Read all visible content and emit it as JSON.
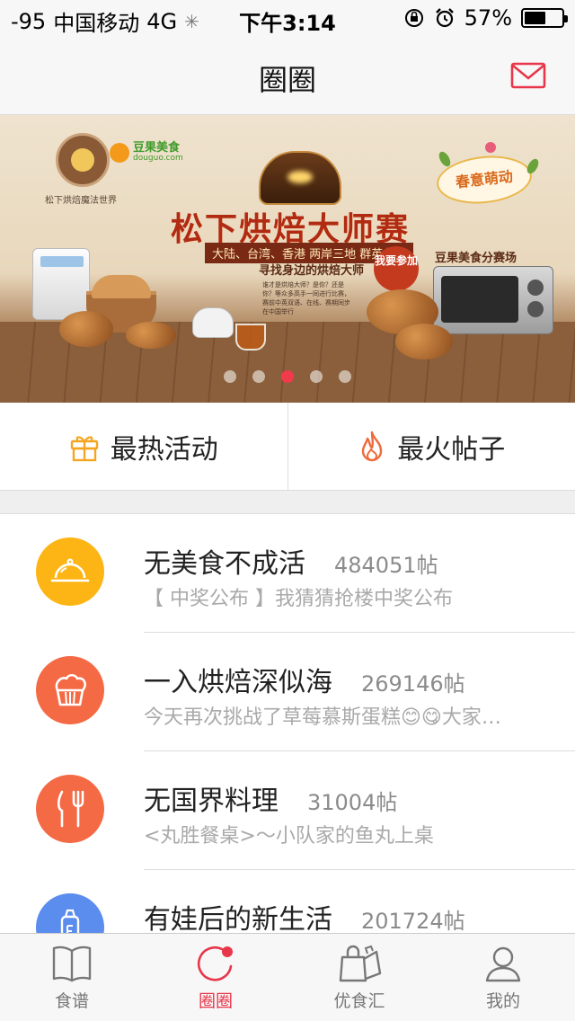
{
  "status_bar": {
    "signal": "-95",
    "carrier": "中国移动",
    "network": "4G",
    "time": "下午3:14",
    "battery": "57%",
    "battery_level": 0.57
  },
  "nav": {
    "title": "圈圈"
  },
  "banner": {
    "brand_caption": "松下烘焙魔法世界",
    "logo_text": "豆果美食",
    "logo_url": "douguo.com",
    "title": "松下烘焙大师赛",
    "subtitle": "大陆、台湾、香港 两岸三地 群英争霸",
    "subtitle2": "寻找身边的烘焙大师",
    "join_label": "我要参加",
    "badge": "春意萌动",
    "venue": "豆果美食分赛场",
    "dots_total": 5,
    "active_dot": 3
  },
  "quick_actions": [
    {
      "label": "最热活动",
      "icon": "gift-icon",
      "color": "#f4a623"
    },
    {
      "label": "最火帖子",
      "icon": "flame-icon",
      "color": "#f06a3b"
    }
  ],
  "circles": [
    {
      "name": "无美食不成活",
      "count": "484051帖",
      "preview": "【 中奖公布 】我猜猜抢楼中奖公布",
      "icon": "cloche-icon",
      "color": "#fdb515"
    },
    {
      "name": "一入烘焙深似海",
      "count": "269146帖",
      "preview": "今天再次挑战了草莓慕斯蛋糕😊😋大家…",
      "icon": "muffin-icon",
      "color": "#f46a45"
    },
    {
      "name": "无国界料理",
      "count": "31004帖",
      "preview": "<丸胜餐桌>～小队家的鱼丸上桌",
      "icon": "fork-knife-icon",
      "color": "#f46a45"
    },
    {
      "name": "有娃后的新生活",
      "count": "201724帖",
      "preview": "",
      "icon": "baby-bottle-icon",
      "color": "#5b8dee"
    }
  ],
  "tabs": [
    {
      "label": "食谱",
      "icon": "book-icon"
    },
    {
      "label": "圈圈",
      "icon": "circle-icon"
    },
    {
      "label": "优食汇",
      "icon": "shopping-bag-icon"
    },
    {
      "label": "我的",
      "icon": "user-icon"
    }
  ],
  "colors": {
    "accent": "#e8364a",
    "tab_inactive": "#777777"
  }
}
